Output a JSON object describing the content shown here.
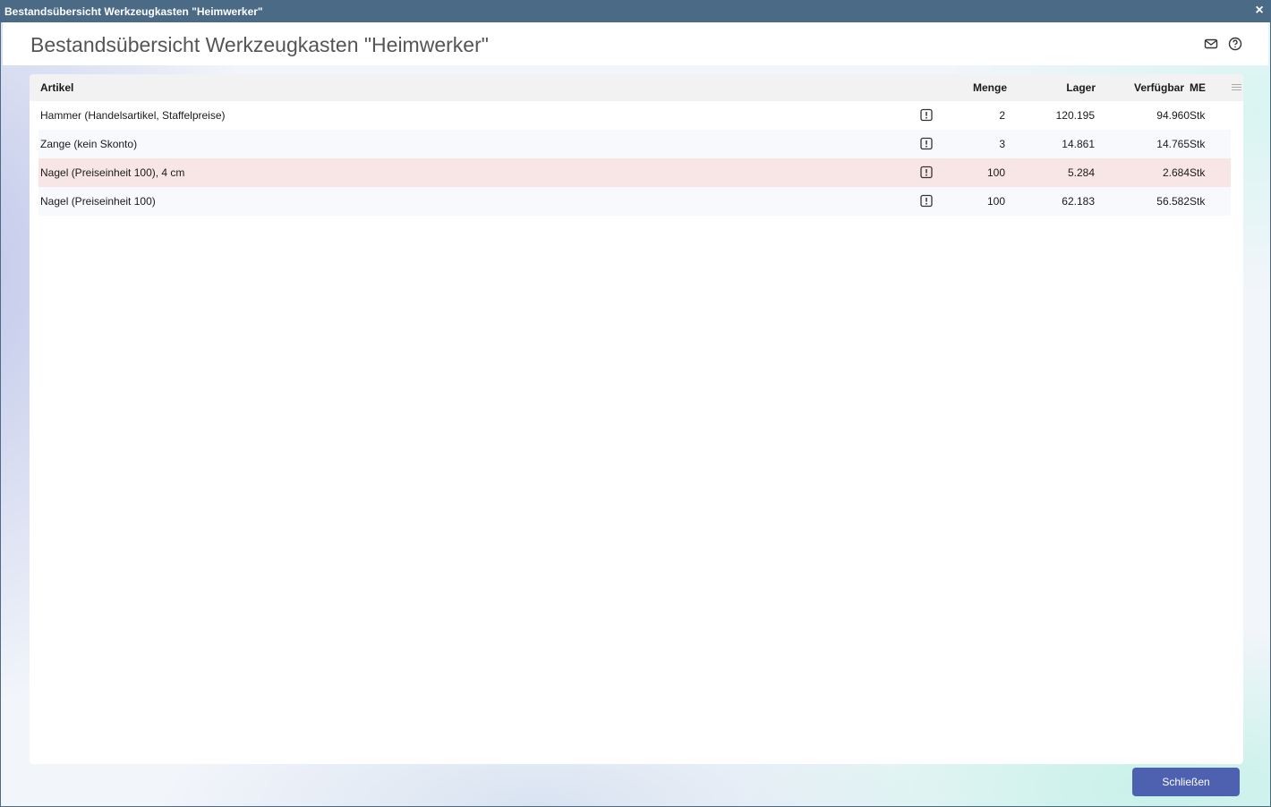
{
  "window": {
    "title": "Bestandsübersicht Werkzeugkasten \"Heimwerker\"",
    "close_glyph": "×"
  },
  "header": {
    "title": "Bestandsübersicht Werkzeugkasten \"Heimwerker\"",
    "icons": [
      "mail-icon",
      "help-icon"
    ]
  },
  "table": {
    "columns": {
      "artikel": "Artikel",
      "menge": "Menge",
      "lager": "Lager",
      "verfuegbar": "Verfügbar",
      "me": "ME"
    },
    "rows": [
      {
        "artikel": "Hammer (Handelsartikel, Staffelpreise)",
        "menge": "2",
        "lager": "120.195",
        "verfuegbar": "94.960",
        "me": "Stk",
        "highlight": false
      },
      {
        "artikel": "Zange (kein Skonto)",
        "menge": "3",
        "lager": "14.861",
        "verfuegbar": "14.765",
        "me": "Stk",
        "highlight": false
      },
      {
        "artikel": "Nagel (Preiseinheit 100), 4 cm",
        "menge": "100",
        "lager": "5.284",
        "verfuegbar": "2.684",
        "me": "Stk",
        "highlight": true
      },
      {
        "artikel": "Nagel (Preiseinheit 100)",
        "menge": "100",
        "lager": "62.183",
        "verfuegbar": "56.582",
        "me": "Stk",
        "highlight": false
      }
    ]
  },
  "footer": {
    "close_label": "Schließen"
  },
  "colors": {
    "titlebar": "#4a6a86",
    "primary_button": "#4e60b0",
    "highlight_row": "#f8e6e6"
  }
}
